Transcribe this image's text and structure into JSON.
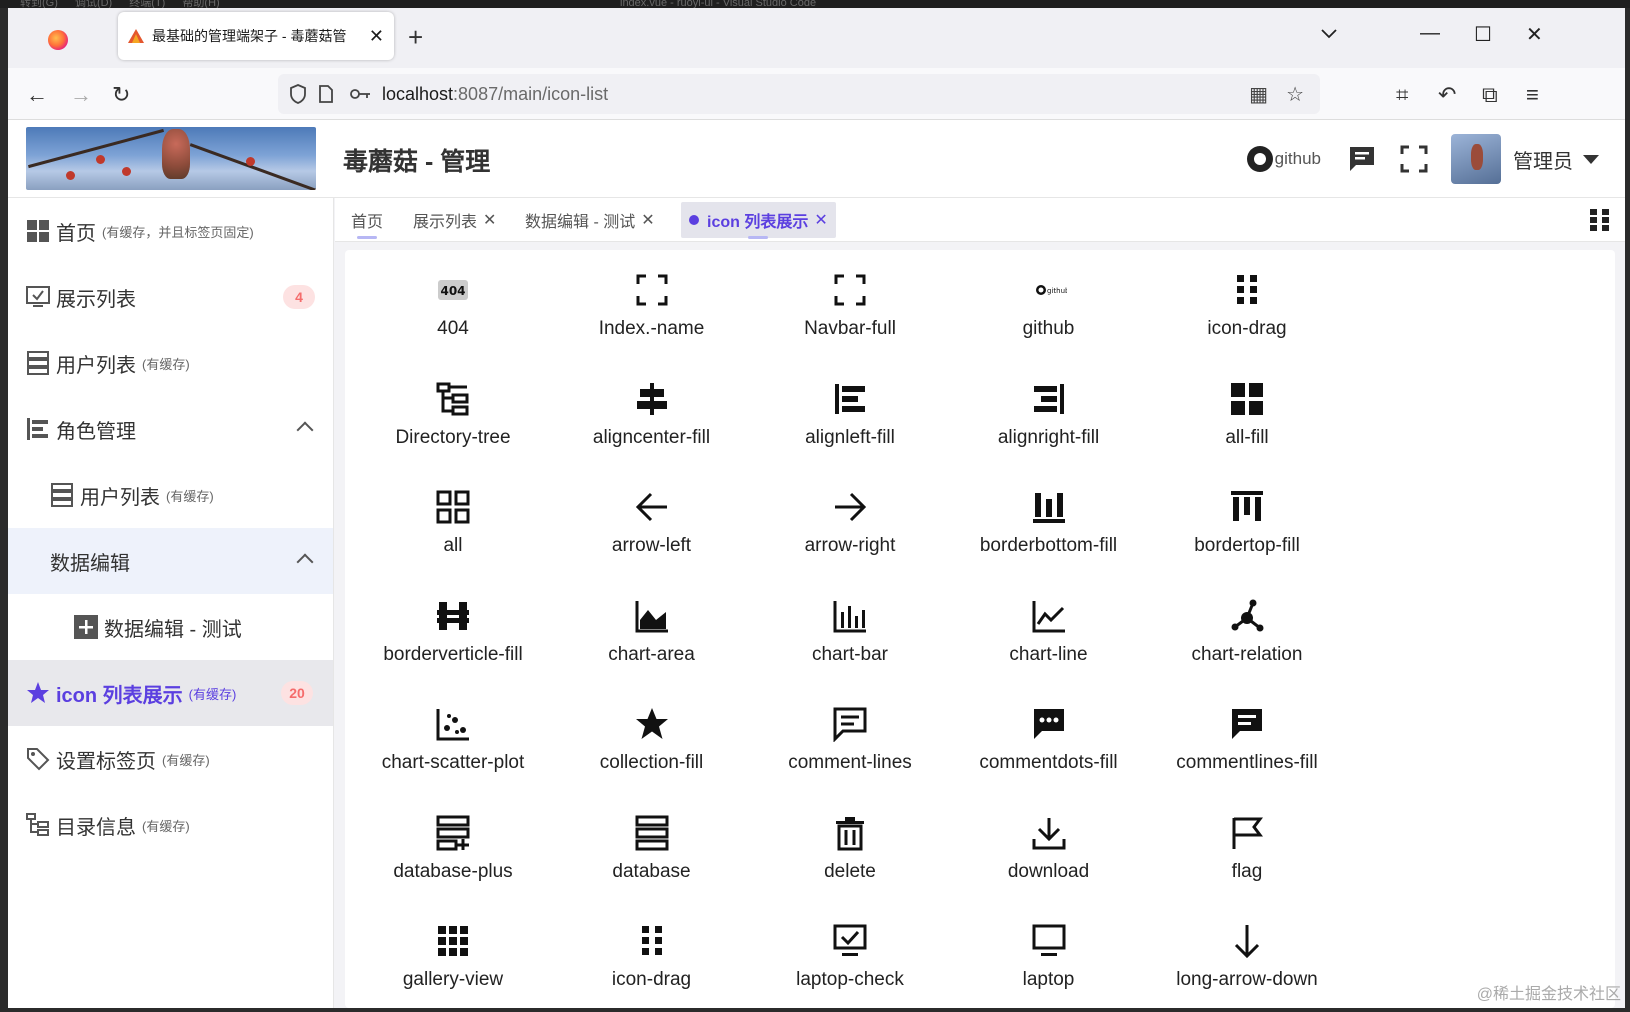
{
  "os_titlebar": {
    "menus": [
      "转到(G)",
      "调试(D)",
      "终端(T)",
      "帮助(H)"
    ],
    "title": "index.vue - ruoyi-ui - Visual Studio Code"
  },
  "browser": {
    "tab_title": "最基础的管理端架子 - 毒蘑菇管",
    "new_tab": "+",
    "url_host": "localhost",
    "url_path": ":8087/main/icon-list"
  },
  "header": {
    "brand": "毒蘑菇 - 管理",
    "github_label": "github",
    "user_name": "管理员"
  },
  "sidebar": {
    "items": [
      {
        "label": "首页",
        "note": "(有缓存，并且标签页固定)"
      },
      {
        "label": "展示列表",
        "badge": "4"
      },
      {
        "label": "用户列表",
        "note": "(有缓存)"
      },
      {
        "label": "角色管理"
      },
      {
        "label": "用户列表",
        "note": "(有缓存)"
      },
      {
        "label": "数据编辑"
      },
      {
        "label": "数据编辑 - 测试"
      },
      {
        "label": "icon 列表展示",
        "note": "(有缓存)",
        "badge": "20"
      },
      {
        "label": "设置标签页",
        "note": "(有缓存)"
      },
      {
        "label": "目录信息",
        "note": "(有缓存)"
      }
    ]
  },
  "tags": [
    {
      "label": "首页"
    },
    {
      "label": "展示列表",
      "close": "✕"
    },
    {
      "label": "数据编辑 - 测试",
      "close": "✕"
    },
    {
      "label": "icon 列表展示",
      "close": "✕"
    }
  ],
  "icons": [
    {
      "name": "404",
      "icon": "404-icon"
    },
    {
      "name": "Index.-name",
      "icon": "fullscreen-icon"
    },
    {
      "name": "Navbar-full",
      "icon": "fullscreen-icon"
    },
    {
      "name": "github",
      "icon": "github-icon"
    },
    {
      "name": "icon-drag",
      "icon": "drag-icon"
    },
    {
      "name": "Directory-tree",
      "icon": "directory-tree-icon"
    },
    {
      "name": "aligncenter-fill",
      "icon": "aligncenter-icon"
    },
    {
      "name": "alignleft-fill",
      "icon": "alignleft-icon"
    },
    {
      "name": "alignright-fill",
      "icon": "alignright-icon"
    },
    {
      "name": "all-fill",
      "icon": "all-fill-icon"
    },
    {
      "name": "all",
      "icon": "all-icon"
    },
    {
      "name": "arrow-left",
      "icon": "arrow-left-icon"
    },
    {
      "name": "arrow-right",
      "icon": "arrow-right-icon"
    },
    {
      "name": "borderbottom-fill",
      "icon": "borderbottom-icon"
    },
    {
      "name": "bordertop-fill",
      "icon": "bordertop-icon"
    },
    {
      "name": "borderverticle-fill",
      "icon": "borderverticle-icon"
    },
    {
      "name": "chart-area",
      "icon": "chart-area-icon"
    },
    {
      "name": "chart-bar",
      "icon": "chart-bar-icon"
    },
    {
      "name": "chart-line",
      "icon": "chart-line-icon"
    },
    {
      "name": "chart-relation",
      "icon": "chart-relation-icon"
    },
    {
      "name": "chart-scatter-plot",
      "icon": "chart-scatter-icon"
    },
    {
      "name": "collection-fill",
      "icon": "star-icon"
    },
    {
      "name": "comment-lines",
      "icon": "comment-lines-icon"
    },
    {
      "name": "commentdots-fill",
      "icon": "comment-dots-icon"
    },
    {
      "name": "commentlines-fill",
      "icon": "comment-lines-fill-icon"
    },
    {
      "name": "database-plus",
      "icon": "database-plus-icon"
    },
    {
      "name": "database",
      "icon": "database-icon"
    },
    {
      "name": "delete",
      "icon": "delete-icon"
    },
    {
      "name": "download",
      "icon": "download-icon"
    },
    {
      "name": "flag",
      "icon": "flag-icon"
    },
    {
      "name": "gallery-view",
      "icon": "gallery-view-icon"
    },
    {
      "name": "icon-drag",
      "icon": "drag-icon"
    },
    {
      "name": "laptop-check",
      "icon": "laptop-check-icon"
    },
    {
      "name": "laptop",
      "icon": "laptop-icon"
    },
    {
      "name": "long-arrow-down",
      "icon": "arrow-down-icon"
    }
  ],
  "watermark": "@稀土掘金技术社区",
  "colors": {
    "accent": "#5b3fe0",
    "badge_bg": "#fde2e2",
    "badge_text": "#f56c6c"
  }
}
